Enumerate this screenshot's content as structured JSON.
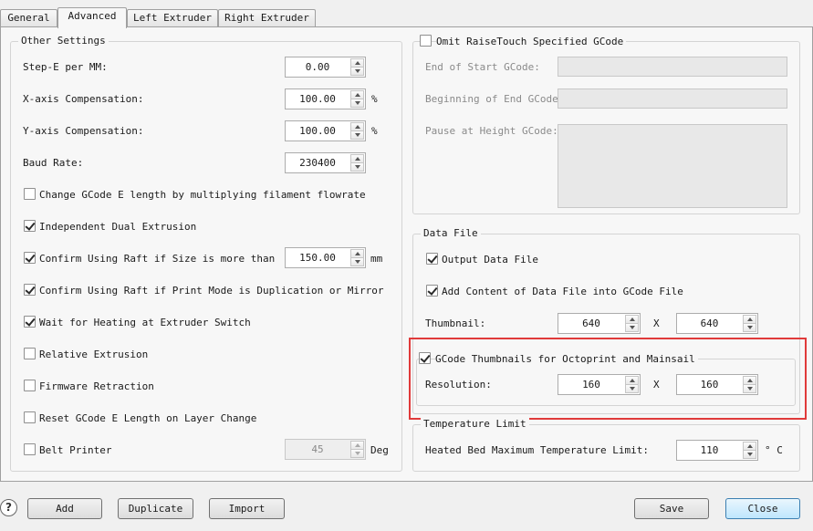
{
  "tabs": [
    "General",
    "Advanced",
    "Left Extruder",
    "Right Extruder"
  ],
  "other": {
    "title": "Other Settings",
    "step_e_label": "Step-E per MM:",
    "step_e_value": "0.00",
    "x_comp_label": "X-axis Compensation:",
    "x_comp_value": "100.00",
    "x_comp_unit": "%",
    "y_comp_label": "Y-axis Compensation:",
    "y_comp_value": "100.00",
    "y_comp_unit": "%",
    "baud_label": "Baud Rate:",
    "baud_value": "230400",
    "change_gcode_label": "Change GCode E length by multiplying filament flowrate",
    "dual_label": "Independent Dual Extrusion",
    "raft_size_label": "Confirm Using Raft if Size is more than",
    "raft_size_value": "150.00",
    "raft_size_unit": "mm",
    "raft_mode_label": "Confirm Using Raft if Print Mode is Duplication or Mirror",
    "heating_label": "Wait for Heating at Extruder Switch",
    "relative_label": "Relative Extrusion",
    "firmware_label": "Firmware Retraction",
    "reset_label": "Reset GCode E Length on Layer Change",
    "belt_label": "Belt Printer",
    "belt_value": "45",
    "belt_unit": "Deg"
  },
  "omit": {
    "title": "Omit RaiseTouch Specified GCode",
    "end_start_label": "End of Start GCode:",
    "begin_end_label": "Beginning of End GCode:",
    "pause_label": "Pause at Height GCode:"
  },
  "data_file": {
    "title": "Data File",
    "output_label": "Output Data File",
    "add_content_label": "Add Content of Data File into GCode File",
    "thumbnail_label": "Thumbnail:",
    "thumb_w": "640",
    "thumb_x": "X",
    "thumb_h": "640",
    "octo_label": "GCode Thumbnails for Octoprint and Mainsail",
    "resolution_label": "Resolution:",
    "res_w": "160",
    "res_x": "X",
    "res_h": "160"
  },
  "temp": {
    "title": "Temperature Limit",
    "bed_label": "Heated Bed Maximum Temperature Limit:",
    "bed_value": "110",
    "bed_unit": "° C"
  },
  "buttons": {
    "help": "?",
    "add": "Add",
    "duplicate": "Duplicate",
    "import": "Import",
    "save": "Save",
    "close": "Close"
  },
  "colors": {
    "highlight": "#e03a3a",
    "default_button": "#3c7fb1"
  }
}
